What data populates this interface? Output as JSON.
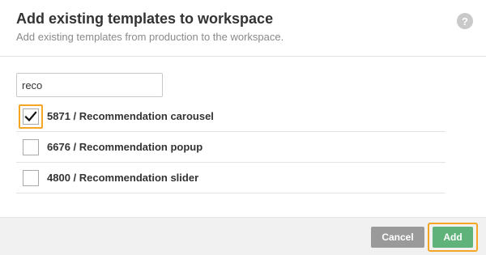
{
  "dialog": {
    "title": "Add existing templates to workspace",
    "subtitle": "Add existing templates from production to the workspace.",
    "help_icon": "?"
  },
  "search": {
    "value": "reco",
    "placeholder": ""
  },
  "templates": [
    {
      "label": "5871 / Recommendation carousel",
      "checked": true
    },
    {
      "label": "6676 / Recommendation popup",
      "checked": false
    },
    {
      "label": "4800 / Recommendation slider",
      "checked": false
    }
  ],
  "footer": {
    "cancel_label": "Cancel",
    "add_label": "Add"
  },
  "colors": {
    "highlight": "#f5a623",
    "add_button": "#5fb27a",
    "cancel_button": "#9a9a9a"
  }
}
